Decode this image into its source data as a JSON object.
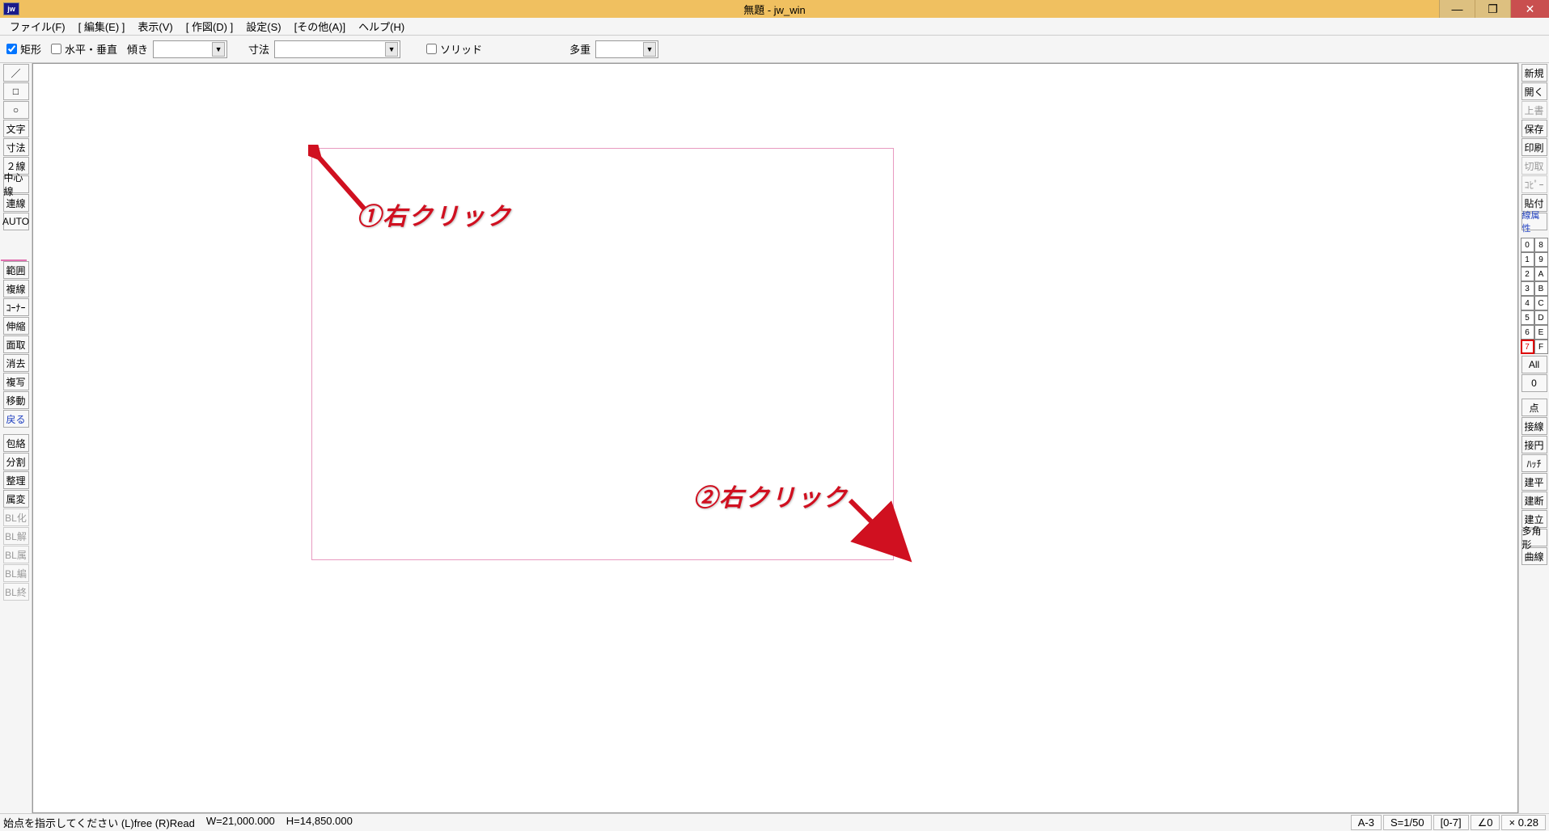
{
  "title": "無題 - jw_win",
  "app_icon": "jw",
  "menu": [
    "ファイル(F)",
    "[ 編集(E) ]",
    "表示(V)",
    "[ 作図(D) ]",
    "設定(S)",
    "[その他(A)]",
    "ヘルプ(H)"
  ],
  "options": {
    "rect_check": "矩形",
    "hv_check": "水平・垂直",
    "tilt_label": "傾き",
    "dim_label": "寸法",
    "solid_label": "ソリッド",
    "multi_label": "多重"
  },
  "left_tools": {
    "line": "／",
    "rect": "□",
    "circle": "○",
    "text": "文字",
    "dim": "寸法",
    "two_line": "２線",
    "center_line": "中心線",
    "polyline": "連線",
    "auto": "AUTO",
    "range": "範囲",
    "dup_line": "複線",
    "corner": "ｺｰﾅｰ",
    "stretch": "伸縮",
    "chamfer": "面取",
    "erase": "消去",
    "copy": "複写",
    "move": "移動",
    "back": "戻る",
    "enclose": "包絡",
    "divide": "分割",
    "tidy": "整理",
    "attrib": "属変",
    "bl_make": "BL化",
    "bl_break": "BL解",
    "bl_attr": "BL属",
    "bl_edit": "BL編",
    "bl_end": "BL終"
  },
  "right_tools": {
    "new": "新規",
    "open": "開く",
    "overwrite": "上書",
    "save": "保存",
    "print": "印刷",
    "cut": "切取",
    "copy": "ｺﾋﾟｰ",
    "paste": "貼付",
    "lineattr": "線属性",
    "all": "All",
    "zero": "0",
    "point": "点",
    "tangent": "接線",
    "tcircle": "接円",
    "hatch": "ﾊｯﾁ",
    "plan": "建平",
    "section": "建断",
    "elev": "建立",
    "polygon": "多角形",
    "curve": "曲線"
  },
  "layer_left": [
    "0",
    "1",
    "2",
    "3",
    "4",
    "5",
    "6",
    "7"
  ],
  "layer_right": [
    "8",
    "9",
    "A",
    "B",
    "C",
    "D",
    "E",
    "F"
  ],
  "annotations": {
    "a1": "①右クリック",
    "a2": "②右クリック"
  },
  "status": {
    "msg": "始点を指示してください (L)free (R)Read",
    "w": "W=21,000.000",
    "h": "H=14,850.000",
    "paper": "A-3",
    "scale": "S=1/50",
    "group": "[0-7]",
    "angle": "∠0",
    "zoom": "× 0.28"
  }
}
